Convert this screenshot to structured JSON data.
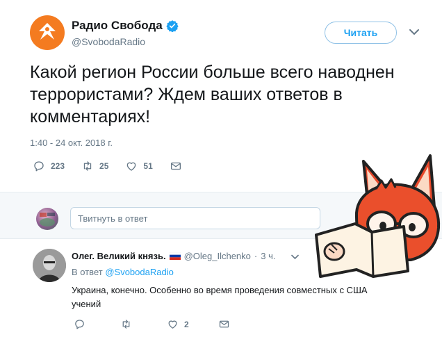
{
  "tweet": {
    "display_name": "Радио Свобода",
    "handle": "@SvobodaRadio",
    "follow_label": "Читать",
    "text": "Какой регион России больше всего наводнен террористами? Ждем ваших ответов в комментариях!",
    "timestamp": "1:40 - 24 окт. 2018 г.",
    "reply_count": "223",
    "retweet_count": "25",
    "like_count": "51",
    "icons": {
      "verified": "verified-badge-icon",
      "caret": "chevron-down-icon",
      "reply": "reply-icon",
      "retweet": "retweet-icon",
      "like": "heart-icon",
      "dm": "envelope-icon"
    }
  },
  "reply_box": {
    "placeholder": "Твитнуть в ответ"
  },
  "reply": {
    "author_name": "Олег. Великий князь.",
    "author_handle": "@Oleg_Ilchenko",
    "separator": "·",
    "time": "3 ч.",
    "replying_prefix": "В ответ",
    "replying_to": "@SvobodaRadio",
    "text": "Украина, конечно. Особенно во время проведения совместных с США учений",
    "reply_count": "",
    "retweet_count": "",
    "like_count": "2",
    "flag": "russia-flag-icon"
  },
  "colors": {
    "brand_orange": "#f47b20",
    "link_blue": "#1da1f2",
    "muted_gray": "#657786",
    "text_dark": "#14171a",
    "reply_bg": "#f5f8fa"
  }
}
